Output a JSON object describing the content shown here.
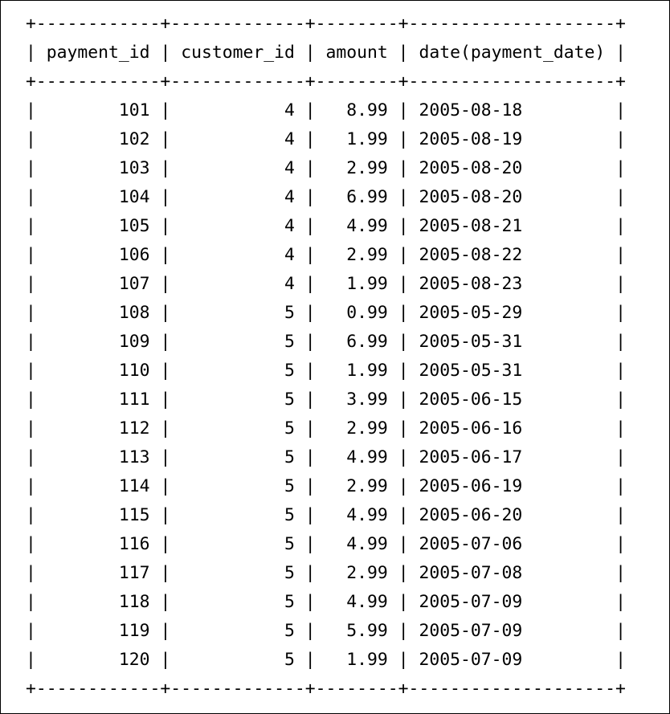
{
  "columns": [
    {
      "label": "payment_id",
      "align": "right"
    },
    {
      "label": "customer_id",
      "align": "right"
    },
    {
      "label": "amount",
      "align": "right"
    },
    {
      "label": "date(payment_date)",
      "align": "left"
    }
  ],
  "rows": [
    [
      "101",
      "4",
      "8.99",
      "2005-08-18"
    ],
    [
      "102",
      "4",
      "1.99",
      "2005-08-19"
    ],
    [
      "103",
      "4",
      "2.99",
      "2005-08-20"
    ],
    [
      "104",
      "4",
      "6.99",
      "2005-08-20"
    ],
    [
      "105",
      "4",
      "4.99",
      "2005-08-21"
    ],
    [
      "106",
      "4",
      "2.99",
      "2005-08-22"
    ],
    [
      "107",
      "4",
      "1.99",
      "2005-08-23"
    ],
    [
      "108",
      "5",
      "0.99",
      "2005-05-29"
    ],
    [
      "109",
      "5",
      "6.99",
      "2005-05-31"
    ],
    [
      "110",
      "5",
      "1.99",
      "2005-05-31"
    ],
    [
      "111",
      "5",
      "3.99",
      "2005-06-15"
    ],
    [
      "112",
      "5",
      "2.99",
      "2005-06-16"
    ],
    [
      "113",
      "5",
      "4.99",
      "2005-06-17"
    ],
    [
      "114",
      "5",
      "2.99",
      "2005-06-19"
    ],
    [
      "115",
      "5",
      "4.99",
      "2005-06-20"
    ],
    [
      "116",
      "5",
      "4.99",
      "2005-07-06"
    ],
    [
      "117",
      "5",
      "2.99",
      "2005-07-08"
    ],
    [
      "118",
      "5",
      "4.99",
      "2005-07-09"
    ],
    [
      "119",
      "5",
      "5.99",
      "2005-07-09"
    ],
    [
      "120",
      "5",
      "1.99",
      "2005-07-09"
    ]
  ]
}
